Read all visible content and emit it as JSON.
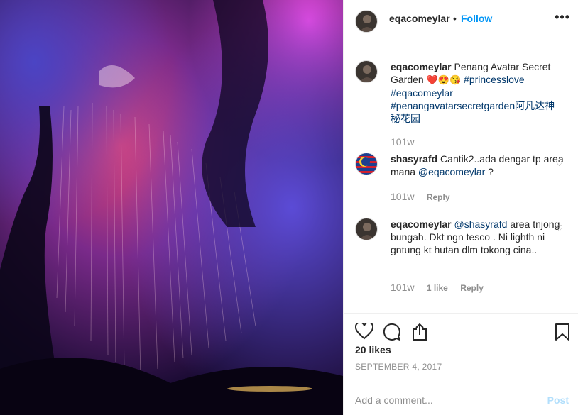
{
  "header": {
    "username": "eqacomeylar",
    "separator": "•",
    "follow_label": "Follow",
    "more_icon": "more-options-icon"
  },
  "caption": {
    "username": "eqacomeylar",
    "text": "Penang Avatar Secret Garden",
    "emojis": "❤️😍😘",
    "hashtags": [
      "#princesslove",
      "#eqacomeylar",
      "#penangavatarsecretgarden阿凡达神秘花园"
    ],
    "time": "101w"
  },
  "comments": [
    {
      "username": "shasyrafd",
      "text": "Cantik2..ada dengar tp area mana",
      "mention": "@eqacomeylar",
      "suffix": " ?",
      "time": "101w",
      "likes": "",
      "reply_label": "Reply"
    },
    {
      "username": "eqacomeylar",
      "mention": "@shasyrafd",
      "text": " area tnjong bungah. Dkt ngn tesco . Ni lighth ni gntung kt hutan dlm tokong cina..",
      "time": "101w",
      "likes": "1 like",
      "reply_label": "Reply"
    }
  ],
  "actions": {
    "like_icon": "heart-icon",
    "comment_icon": "comment-icon",
    "share_icon": "share-icon",
    "save_icon": "bookmark-icon"
  },
  "likes_text": "20 likes",
  "date_text": "SEPTEMBER 4, 2017",
  "add_comment": {
    "placeholder": "Add a comment...",
    "post_label": "Post"
  },
  "colors": {
    "link": "#0095f6",
    "hashtag": "#00376b",
    "muted": "#8e8e8e",
    "post_disabled": "#b2dffc"
  }
}
